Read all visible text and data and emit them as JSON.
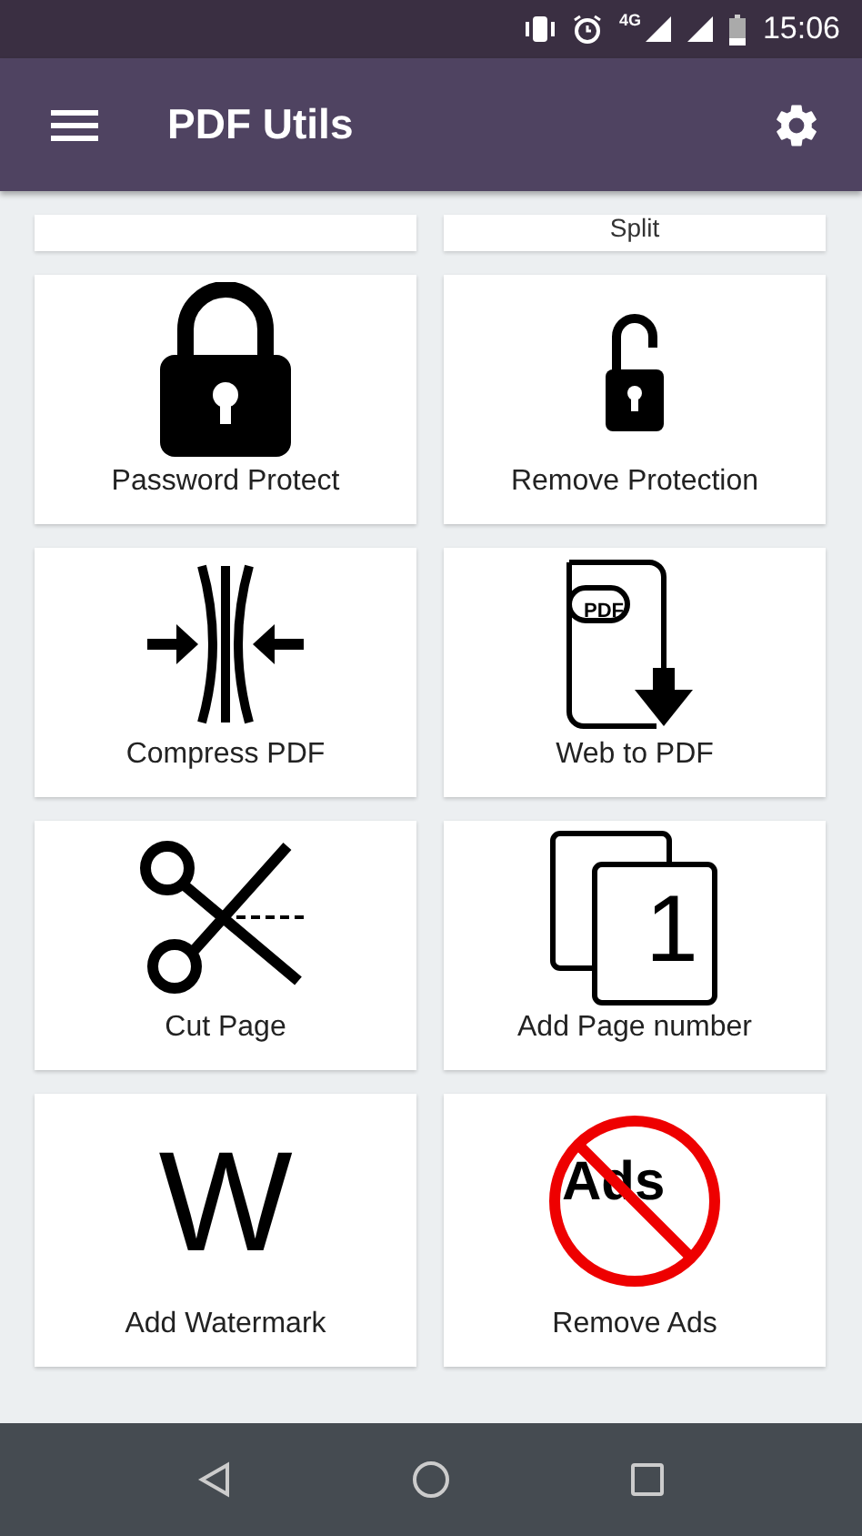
{
  "status_bar": {
    "network": "4G",
    "time": "15:06"
  },
  "app_bar": {
    "title": "PDF Utils"
  },
  "partial_row": {
    "right_label": "Split"
  },
  "rows": [
    {
      "cards": [
        {
          "kind": "lock",
          "label": "Password Protect"
        },
        {
          "kind": "unlock",
          "label": "Remove Protection"
        }
      ]
    },
    {
      "cards": [
        {
          "kind": "compress",
          "label": "Compress PDF"
        },
        {
          "kind": "web",
          "label": "Web to PDF",
          "icon_text": "PDF"
        }
      ]
    },
    {
      "cards": [
        {
          "kind": "scissors",
          "label": "Cut Page"
        },
        {
          "kind": "pages",
          "label": "Add Page number",
          "icon_text": "1"
        }
      ]
    },
    {
      "cards": [
        {
          "kind": "letter",
          "label": "Add Watermark",
          "icon_text": "W"
        },
        {
          "kind": "noads",
          "label": "Remove Ads",
          "icon_text": "Ads"
        }
      ]
    }
  ]
}
